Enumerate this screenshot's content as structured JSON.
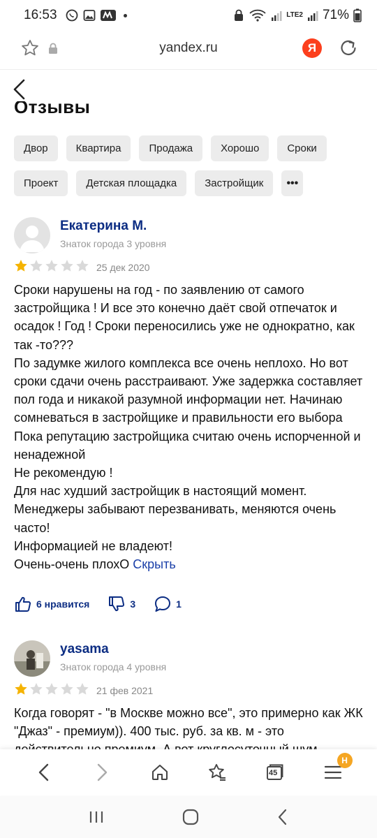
{
  "status": {
    "time": "16:53",
    "battery_pct": "71%",
    "network": "LTE2"
  },
  "browser": {
    "url": "yandex.ru",
    "logo_letter": "Я",
    "tabs_count": "45",
    "menu_badge": "H"
  },
  "page": {
    "title": "Отзывы"
  },
  "chips": {
    "row1": [
      "Двор",
      "Квартира",
      "Продажа",
      "Хорошо",
      "Сроки"
    ],
    "row2": [
      "Проект",
      "Детская площадка",
      "Застройщик"
    ],
    "more": "•••"
  },
  "reviews": [
    {
      "author": "Екатерина М.",
      "level": "Знаток города 3 уровня",
      "rating": 1,
      "rating_max": 5,
      "date": "25 дек 2020",
      "text": "Сроки нарушены на год - по заявлению от самого застройщика ! И все это конечно даёт свой отпечаток и осадок ! Год ! Сроки переносились уже не однократно, как так -то???\nПо задумке жилого комплекса все очень неплохо. Но вот сроки сдачи очень расстраивают. Уже задержка составляет пол года и никакой разумной информации нет. Начинаю сомневаться в застройщике и правильности его выбора\nПока репутацию застройщика считаю очень испорченной и ненадежной\nНе рекомендую !\nДля нас худший застройщик в настоящий момент. Менеджеры забывают перезванивать, меняются очень часто!\nИнформацией не владеют!\nОчень-очень плохО ",
      "hide_label": "Скрыть",
      "likes": "6 нравится",
      "dislikes": "3",
      "comments": "1"
    },
    {
      "author": "yasama",
      "level": "Знаток города 4 уровня",
      "rating": 1,
      "rating_max": 5,
      "date": "21 фев 2021",
      "text": "Когда говорят - \"в Москве можно все\", это примерно как ЖК \"Джаз\" - премиум)). 400 тыс. руб. за кв. м - это действительно премиум. А вот круглосуточный шум"
    }
  ],
  "colors": {
    "link": "#0c2d83",
    "star_on": "#f5b301",
    "star_off": "#d9d9d9",
    "chip_bg": "#ececec",
    "yandex_red": "#fc3f1d"
  }
}
